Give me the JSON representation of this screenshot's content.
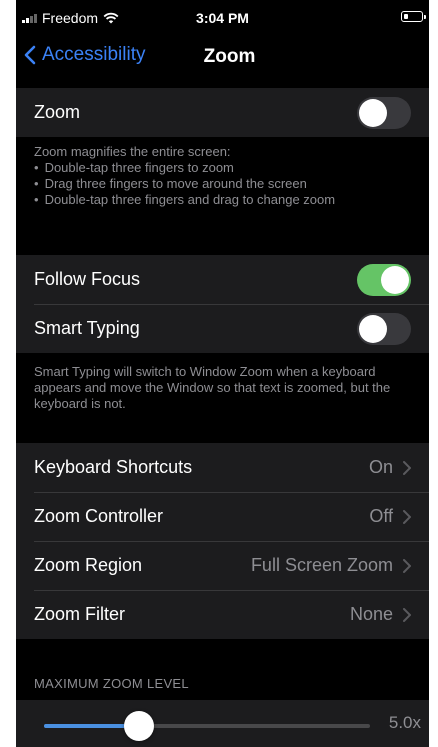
{
  "status_bar": {
    "carrier": "Freedom",
    "time": "3:04 PM",
    "battery_level": 0.3
  },
  "nav": {
    "back_label": "Accessibility",
    "title": "Zoom"
  },
  "zoom_section": {
    "zoom_label": "Zoom",
    "zoom_on": false,
    "footer_title": "Zoom magnifies the entire screen:",
    "footer_items": [
      "Double-tap three fingers to zoom",
      "Drag three fingers to move around the screen",
      "Double-tap three fingers and drag to change zoom"
    ]
  },
  "focus_section": {
    "follow_focus_label": "Follow Focus",
    "follow_focus_on": true,
    "smart_typing_label": "Smart Typing",
    "smart_typing_on": false,
    "footer": "Smart Typing will switch to Window Zoom when a keyboard appears and move the Window so that text is zoomed, but the keyboard is not."
  },
  "options": [
    {
      "label": "Keyboard Shortcuts",
      "value": "On"
    },
    {
      "label": "Zoom Controller",
      "value": "Off"
    },
    {
      "label": "Zoom Region",
      "value": "Full Screen Zoom"
    },
    {
      "label": "Zoom Filter",
      "value": "None"
    }
  ],
  "max_zoom": {
    "header": "MAXIMUM ZOOM LEVEL",
    "value_label": "5.0x",
    "slider_fraction": 0.29
  },
  "colors": {
    "accent": "#3b82f6",
    "toggle_on": "#65c466",
    "background": "#000000",
    "cell": "#1c1c1e"
  }
}
